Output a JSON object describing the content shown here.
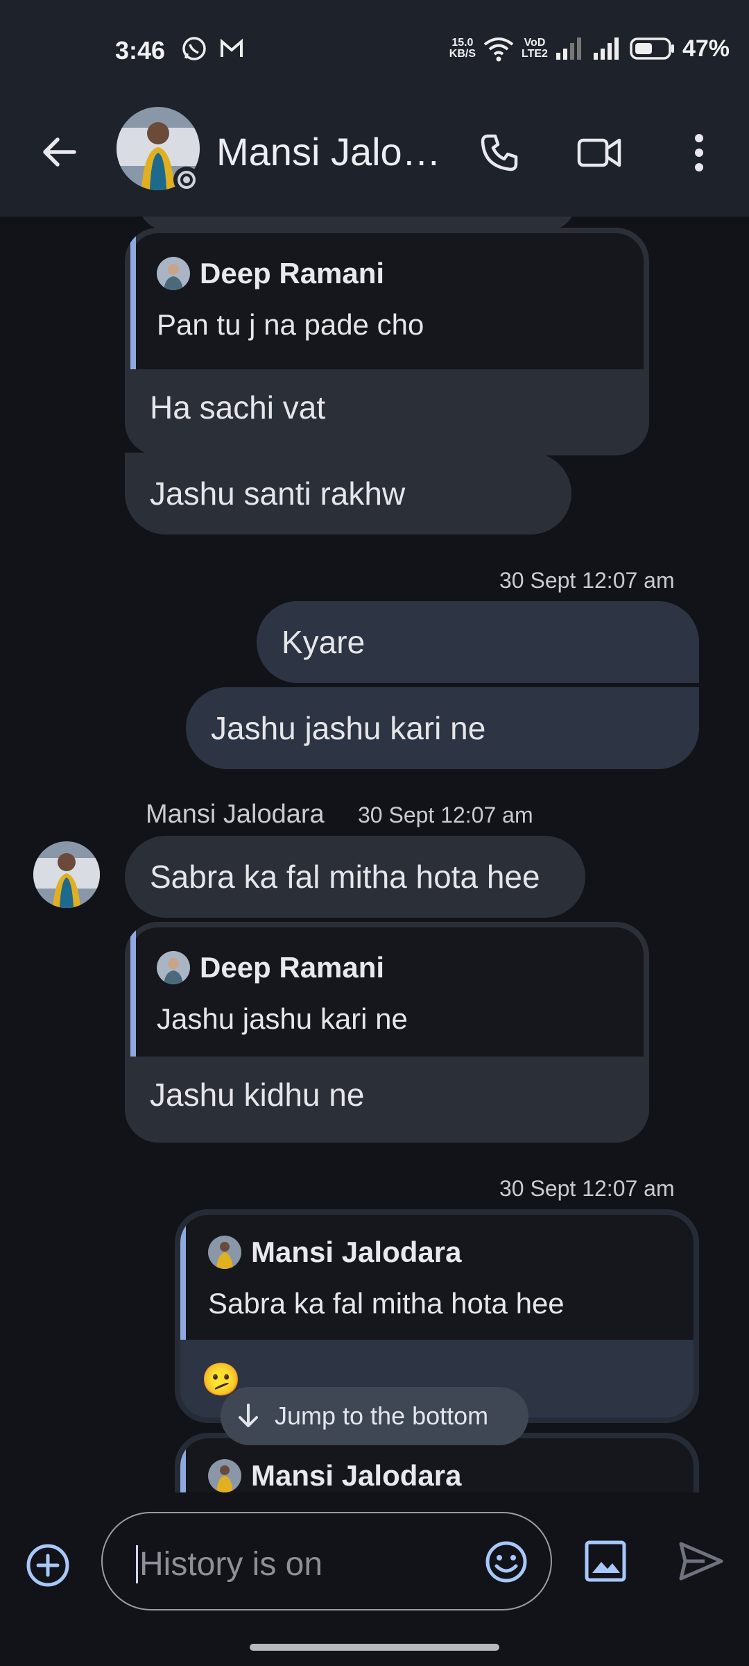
{
  "status_bar": {
    "time": "3:46",
    "net_speed_value": "15.0",
    "net_speed_unit": "KB/S",
    "vo_label": "VoD",
    "lte_label": "LTE2",
    "battery_pct": "47%"
  },
  "header": {
    "contact_name": "Mansi Jalo…",
    "actions": [
      "phone-icon",
      "video-icon",
      "more-icon"
    ]
  },
  "messages": [
    {
      "id": "r1",
      "type": "reply",
      "direction": "incoming",
      "quote_author": "Deep Ramani",
      "quote_text": "Pan tu j na pade cho",
      "text": "Ha sachi vat"
    },
    {
      "id": "m1",
      "type": "text",
      "direction": "incoming",
      "text": "Jashu santi rakhw"
    },
    {
      "id": "t1",
      "type": "timestamp",
      "text": "30 Sept 12:07 am"
    },
    {
      "id": "m2",
      "type": "text",
      "direction": "outgoing",
      "text": "Kyare"
    },
    {
      "id": "m3",
      "type": "text",
      "direction": "outgoing",
      "text": "Jashu jashu kari ne"
    },
    {
      "id": "s1",
      "type": "sender",
      "sender": "Mansi Jalodara",
      "time": "30 Sept 12:07 am"
    },
    {
      "id": "m4",
      "type": "text",
      "direction": "incoming",
      "text": "Sabra ka fal mitha hota hee"
    },
    {
      "id": "r2",
      "type": "reply",
      "direction": "incoming",
      "quote_author": "Deep Ramani",
      "quote_text": "Jashu jashu kari ne",
      "text": "Jashu kidhu ne"
    },
    {
      "id": "t2",
      "type": "timestamp",
      "text": "30 Sept 12:07 am"
    },
    {
      "id": "r3",
      "type": "reply",
      "direction": "outgoing",
      "quote_author": "Mansi Jalodara",
      "quote_text": "Sabra ka fal mitha hota hee",
      "text": "🫤"
    },
    {
      "id": "r4",
      "type": "reply",
      "direction": "outgoing",
      "quote_author": "Mansi Jalodara",
      "quote_text": "",
      "text": ""
    }
  ],
  "jump_button": "Jump to the bottom",
  "composer": {
    "placeholder": "History is on"
  },
  "colors": {
    "background": "#111318",
    "appbar": "#1e222a",
    "incoming_bubble": "#2b2f38",
    "outgoing_bubble": "#2d3443",
    "quote_bar": "#8fa8e0",
    "accent": "#a8c7fa"
  }
}
